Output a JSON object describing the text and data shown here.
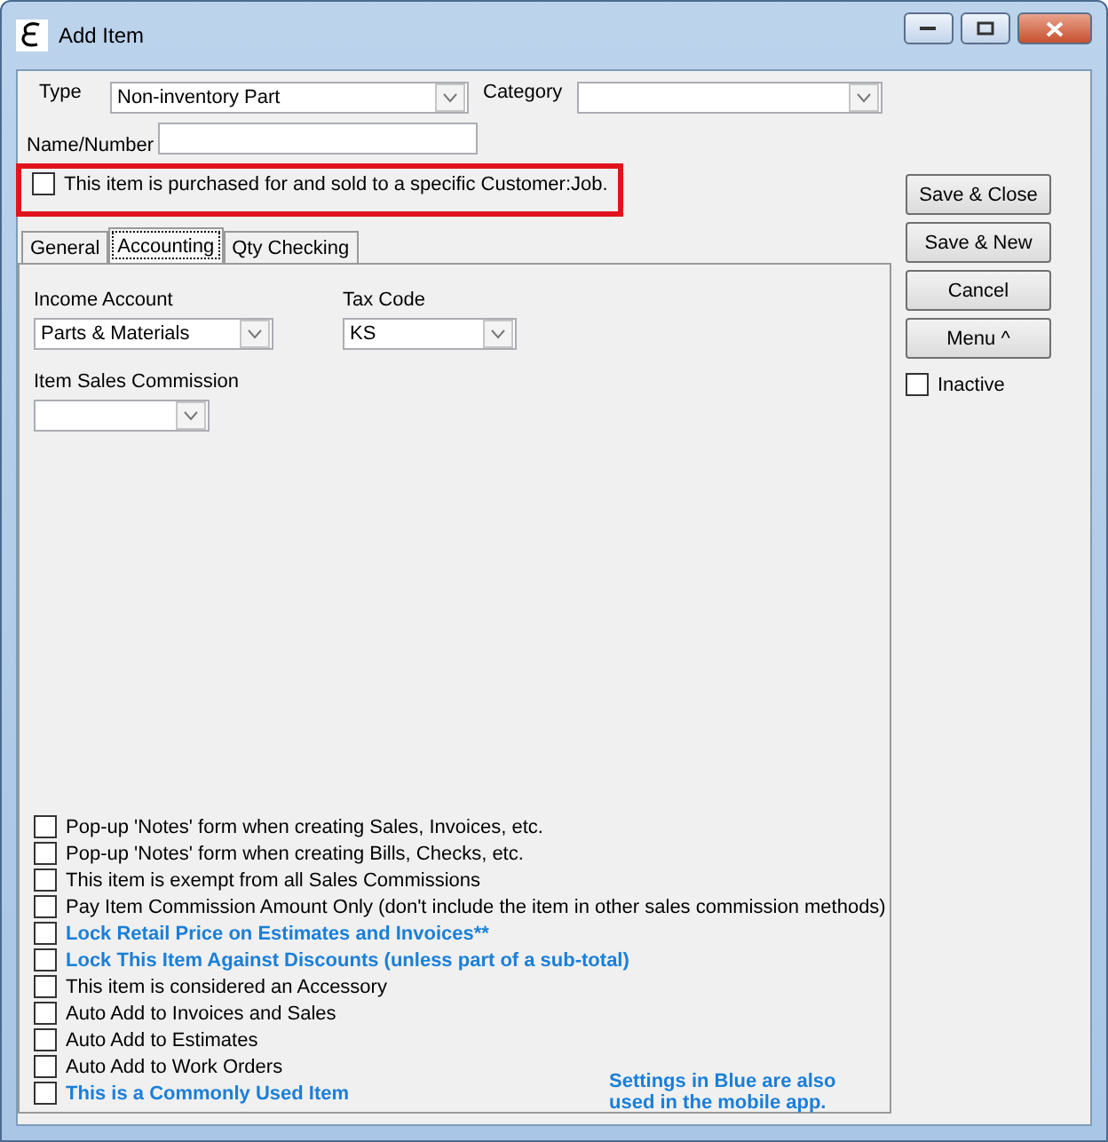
{
  "window": {
    "title": "Add Item"
  },
  "type_field": {
    "label": "Type",
    "value": "Non-inventory Part"
  },
  "category_field": {
    "label": "Category"
  },
  "name_field": {
    "label": "Name/Number"
  },
  "customer_job": {
    "label": "This item is purchased for and sold to a specific Customer:Job.",
    "checked": false,
    "highlighted": true
  },
  "tabs": [
    {
      "label": "General",
      "selected": false
    },
    {
      "label": "Accounting",
      "selected": true
    },
    {
      "label": "Qty Checking",
      "selected": false
    }
  ],
  "accounting": {
    "income_account": {
      "label": "Income Account",
      "value": "Parts & Materials"
    },
    "tax_code": {
      "label": "Tax Code",
      "value": "KS"
    },
    "sales_commission": {
      "label": "Item Sales Commission"
    }
  },
  "options": [
    {
      "label": "Pop-up 'Notes' form when creating Sales, Invoices, etc.",
      "checked": false,
      "mobile": false
    },
    {
      "label": "Pop-up 'Notes' form when creating Bills, Checks, etc.",
      "checked": false,
      "mobile": false
    },
    {
      "label": "This item is exempt from all Sales Commissions",
      "checked": false,
      "mobile": false
    },
    {
      "label": "Pay Item Commission Amount Only (don't include the item in other sales commission methods)",
      "checked": false,
      "mobile": false
    },
    {
      "label": "Lock Retail Price on Estimates and Invoices**",
      "checked": false,
      "mobile": true
    },
    {
      "label": "Lock This Item Against Discounts (unless part of a sub-total)",
      "checked": false,
      "mobile": true
    },
    {
      "label": "This item is considered an Accessory",
      "checked": false,
      "mobile": false
    },
    {
      "label": "Auto Add to Invoices and Sales",
      "checked": false,
      "mobile": false
    },
    {
      "label": "Auto Add to Estimates",
      "checked": false,
      "mobile": false
    },
    {
      "label": "Auto Add to Work Orders",
      "checked": false,
      "mobile": false
    },
    {
      "label": "This is a Commonly Used Item",
      "checked": false,
      "mobile": true
    }
  ],
  "note": "Settings in Blue are also used in the mobile app.",
  "buttons": [
    "Save & Close",
    "Save & New",
    "Cancel",
    "Menu ^"
  ],
  "inactive": {
    "label": "Inactive",
    "checked": false
  }
}
